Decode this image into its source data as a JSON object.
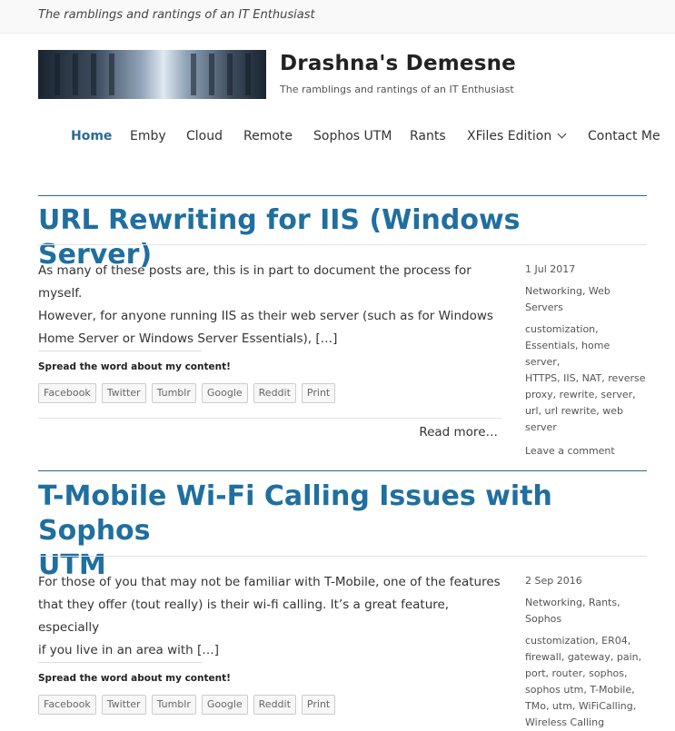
{
  "site": {
    "topbar_tagline": "The ramblings and rantings of an IT Enthusiast",
    "title": "Drashna's Demesne",
    "description": "The ramblings and rantings of an IT Enthusiast",
    "banner_icon": "server-room-banner-image"
  },
  "nav": {
    "items": [
      {
        "label": "Home"
      },
      {
        "label": "Emby"
      },
      {
        "label": "Cloud"
      },
      {
        "label": "Remote"
      },
      {
        "label": "Sophos UTM"
      },
      {
        "label": "Rants"
      },
      {
        "label": "XFiles Edition"
      },
      {
        "label": "Contact Me"
      }
    ],
    "active": "Home"
  },
  "colors": {
    "accent": "#1f6f9f",
    "text": "#333333"
  },
  "posts": [
    {
      "title": "URL Rewriting for IIS (Windows Server)",
      "excerpt_lines": [
        "As many of these posts are, this is in part to document the process for myself.",
        " However, for anyone running IIS as their web server (such as for Windows",
        "Home Server or Windows Server Essentials), […]"
      ],
      "share_heading": "Spread the word about my content!",
      "share_buttons": [
        "Facebook",
        "Twitter",
        "Tumblr",
        "Google",
        "Reddit",
        "Print"
      ],
      "read_more": "Read more…",
      "date": "1 Jul 2017",
      "categories_lines": [
        "Networking, Web",
        "Servers"
      ],
      "tags_lines": [
        "customization,",
        "Essentials, home server,",
        "HTTPS, IIS, NAT, reverse",
        "proxy, rewrite, server,",
        "url, url rewrite, web",
        "server"
      ],
      "comment": "Leave a comment"
    },
    {
      "title_lines": [
        "T-Mobile Wi-Fi Calling Issues with Sophos",
        "UTM"
      ],
      "excerpt_lines": [
        "For those of you that may not be familiar with T-Mobile, one of the features",
        "that they offer (tout really) is their wi-fi calling.  It’s a great feature, especially",
        "if you live in an area with […]"
      ],
      "share_heading": "Spread the word about my content!",
      "share_buttons": [
        "Facebook",
        "Twitter",
        "Tumblr",
        "Google",
        "Reddit",
        "Print"
      ],
      "date": "2 Sep 2016",
      "categories_lines": [
        "Networking, Rants,",
        "Sophos"
      ],
      "tags_lines": [
        "customization, ER04,",
        "firewall, gateway, pain,",
        "port, router, sophos,",
        "sophos utm, T-Mobile,",
        "TMo, utm, WiFiCalling,",
        "Wireless Calling"
      ]
    }
  ]
}
